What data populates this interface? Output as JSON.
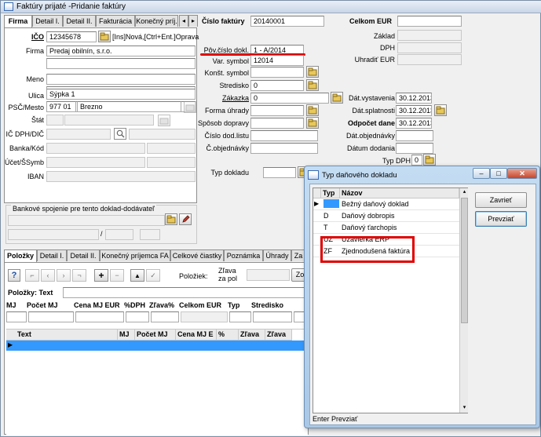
{
  "window": {
    "title": "Faktúry prijaté -Pridanie faktúry"
  },
  "top_tabs": [
    "Firma",
    "Detail I.",
    "Detail II.",
    "Fakturácia",
    "Konečný príj."
  ],
  "firma": {
    "ico_label": "IČO",
    "ico": "12345678",
    "ico_hint": "[Ins]Nová,[Ctrl+Ent.]Oprava",
    "firma_label": "Firma",
    "firma": "Predaj obilnín, s.r.o.",
    "meno_label": "Meno",
    "ulica_label": "Ulica",
    "ulica": "Sýpka 1",
    "psc_label": "PSČ/Mesto",
    "psc": "977 01",
    "mesto": "Brezno",
    "stat_label": "Štát",
    "icdph_label": "IČ DPH/DIČ",
    "banka_label": "Banka/Kód",
    "ucet_label": "Účet/ŠSymb",
    "iban_label": "IBAN",
    "bank_label": "Bankové spojenie pre tento doklad-dodávateľ",
    "slash": "/"
  },
  "doc": {
    "cislo_label": "Číslo faktúry",
    "cislo": "20140001",
    "pov_label": "Pôv.číslo dokl.",
    "pov": "1 - A/2014",
    "vs_label": "Var. symbol",
    "vs": "12014",
    "ks_label": "Konšt. symbol",
    "stred_label": "Stredisko",
    "stred": "0",
    "zak_label": "Zákazka",
    "zak": "0",
    "forma_label": "Forma úhrady",
    "sposob_label": "Spôsob dopravy",
    "dodlist_label": "Číslo dod.listu",
    "objed_label": "Č.objednávky",
    "typdok_label": "Typ dokladu"
  },
  "dates": {
    "celkom_label": "Celkom EUR",
    "zaklad_label": "Základ",
    "dph_label": "DPH",
    "uhradit_label": "Uhradiť EUR",
    "vyst_label": "Dát.vystavenia",
    "vyst": "30.12.2013",
    "splat_label": "Dát.splatnosti",
    "splat": "30.12.2013",
    "odpocet_label": "Odpočet dane",
    "odpocet": "30.12.2013",
    "datobj_label": "Dát.objednávky",
    "datdod_label": "Dátum dodania",
    "typdph_label": "Typ DPH",
    "typdph": "0"
  },
  "bottom_tabs": [
    "Položky",
    "Detail I.",
    "Detail II.",
    "Konečný príjemca FA",
    "Celkové čiastky",
    "Poznámka",
    "Úhrady",
    "Za"
  ],
  "items": {
    "polozka_label": "Položiek:",
    "zlava_label": "Zľava za pol",
    "zo_label": "Zo",
    "pol_text_label": "Položky: Text",
    "cols1": [
      "MJ",
      "Počet MJ",
      "Cena MJ EUR",
      "%DPH",
      "Zľava%",
      "Celkom EUR",
      "Typ",
      "Stredisko"
    ],
    "cols2": [
      "Text",
      "MJ",
      "Počet MJ",
      "Cena MJ E",
      "%",
      "Zľava",
      "Zľava"
    ]
  },
  "dialog": {
    "title": "Typ daňového dokladu",
    "col_typ": "Typ",
    "col_nazov": "Názov",
    "rows": [
      {
        "typ": "",
        "nazov": "Bežný daňový doklad"
      },
      {
        "typ": "D",
        "nazov": "Daňový dobropis"
      },
      {
        "typ": "T",
        "nazov": "Daňový ťarchopis"
      },
      {
        "typ": "UZ",
        "nazov": "Uzávierka ERP"
      },
      {
        "typ": "ZF",
        "nazov": "Zjednodušená faktúra"
      }
    ],
    "close_label": "Zavrieť",
    "take_label": "Prevziať",
    "status": "Enter Prevziať"
  },
  "colors": {
    "highlight": "#e00000",
    "selection": "#3399ff",
    "title_gradient": "#c9d6e6"
  }
}
